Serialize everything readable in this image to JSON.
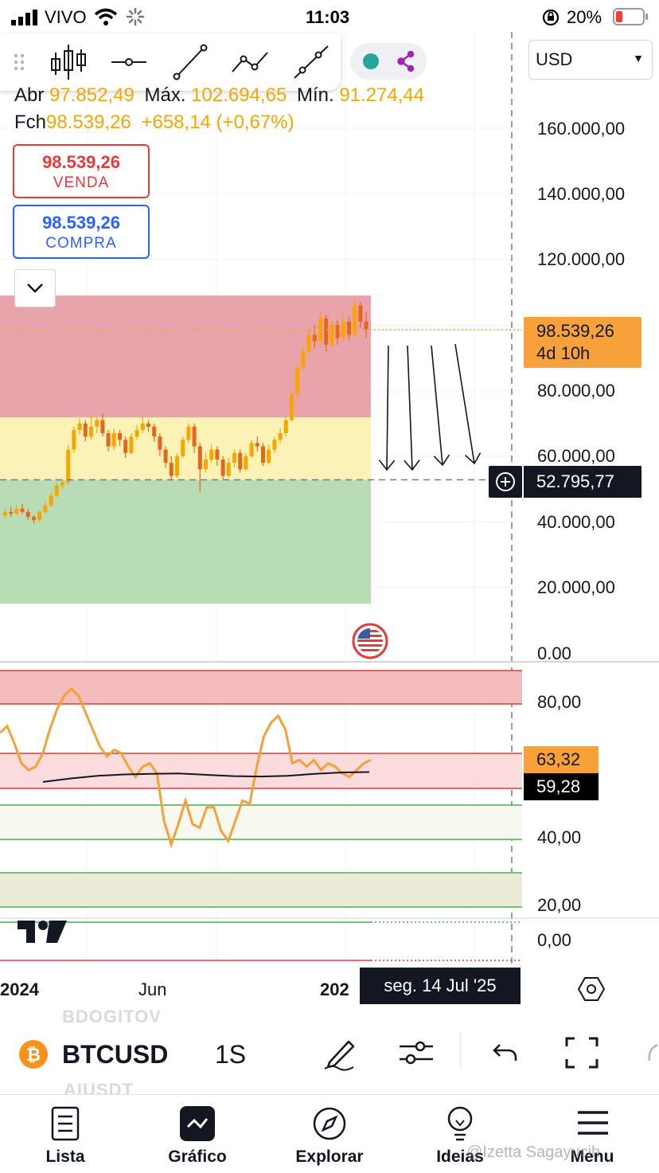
{
  "status_bar": {
    "carrier": "VIVO",
    "time": "11:03",
    "battery": "20%"
  },
  "drawing_toolbar": {
    "tools": [
      "drag-handle-icon",
      "candles-icon",
      "horizontal-line-icon",
      "trend-line-icon",
      "polyline-icon",
      "ray-icon"
    ],
    "toggle_colors": {
      "dot": "#26a69a",
      "graph": "#9c27b0"
    }
  },
  "currency": {
    "selected": "USD"
  },
  "ohlc": {
    "open_label": "Abr",
    "open": "97.852,49",
    "high_label": "Máx.",
    "high": "102.694,65",
    "low_label": "Mín.",
    "low": "91.274,44",
    "close_label": "Fch",
    "close": "98.539,26",
    "change": "+658,14 (+0,67%)"
  },
  "trade_buttons": {
    "sell_price": "98.539,26",
    "sell_label": "VENDA",
    "buy_price": "98.539,26",
    "buy_label": "COMPRA"
  },
  "price_axis": {
    "labels": [
      "160.000,00",
      "140.000,00",
      "120.000,00",
      "80.000,00",
      "60.000,00",
      "40.000,00",
      "20.000,00",
      "0.00"
    ],
    "current_price": "98.539,26",
    "countdown": "4d 10h",
    "crosshair_price": "52.795,77"
  },
  "zones": {
    "red": {
      "from": 71800,
      "to": 109000,
      "color": "#e8a4aa"
    },
    "yellow": {
      "from": 52800,
      "to": 71800,
      "color": "#fbf3b6"
    },
    "green": {
      "from": 15000,
      "to": 52800,
      "color": "#b8dcb4"
    }
  },
  "rsi_panel": {
    "labels": [
      "80,00",
      "40,00",
      "20,00",
      "0,00"
    ],
    "rsi_value": "63,32",
    "ma_value": "59,28"
  },
  "time_axis": {
    "labels": [
      "2024",
      "Jun",
      "202"
    ],
    "crosshair_date": "seg. 14 Jul '25"
  },
  "symbol_bar": {
    "symbol": "BTCUSD",
    "interval": "1S",
    "ghost_above": "BDOGITOV",
    "ghost_below": "AIUSDT"
  },
  "bottom_tabs": [
    {
      "label": "Lista",
      "icon": "list-icon"
    },
    {
      "label": "Gráfico",
      "icon": "chart-icon"
    },
    {
      "label": "Explorar",
      "icon": "compass-icon"
    },
    {
      "label": "Ideias",
      "icon": "lightbulb-icon"
    },
    {
      "label": "Menu",
      "icon": "menu-icon"
    }
  ],
  "watermark": "@Izetta Sagayucih",
  "colors": {
    "up": "#f7a600",
    "down": "#e8651c",
    "rsi": "#f5a13a",
    "accent": "#2962ff",
    "sell": "#e33b3b"
  }
}
